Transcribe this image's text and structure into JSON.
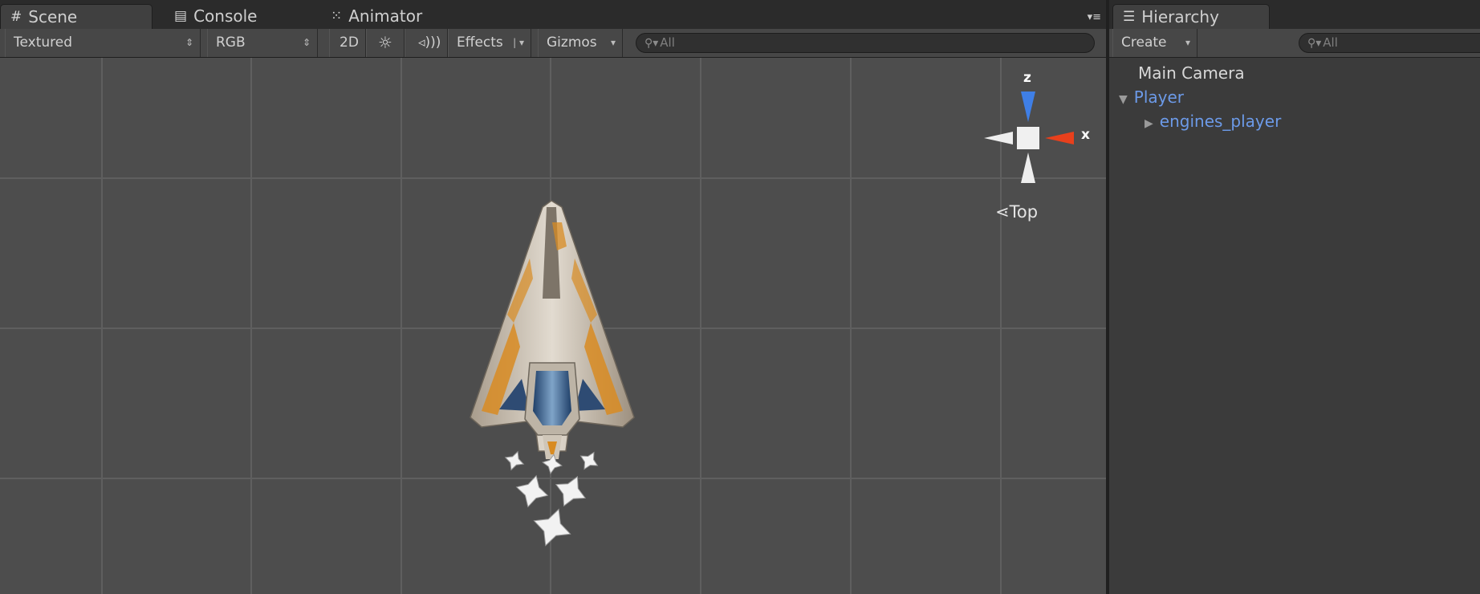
{
  "scene_tabs": {
    "scene": "Scene",
    "console": "Console",
    "animator": "Animator"
  },
  "scene_toolbar": {
    "render_mode": "Textured",
    "channel": "RGB",
    "mode_2d": "2D",
    "effects": "Effects",
    "gizmos": "Gizmos",
    "search_placeholder": "All"
  },
  "hierarchy": {
    "tab": "Hierarchy",
    "create": "Create",
    "search_placeholder": "All",
    "items": [
      {
        "label": "Main Camera",
        "depth": 0,
        "expanded": null,
        "color": "default"
      },
      {
        "label": "Player",
        "depth": 0,
        "expanded": true,
        "color": "#6c9ae8"
      },
      {
        "label": "engines_player",
        "depth": 1,
        "expanded": false,
        "color": "#6c9ae8"
      }
    ]
  },
  "gizmo": {
    "z_label": "z",
    "x_label": "x",
    "view_label": "Top"
  },
  "colors": {
    "viewport_bg": "#4d4d4d",
    "grid_line": "#5f5f5f",
    "selected_blue": "#6c9ae8",
    "axis_x": "#e8401c",
    "axis_z": "#3f7fe6"
  },
  "icons": {
    "scene_tab": "grid-icon",
    "console_tab": "console-icon",
    "animator_tab": "animator-icon",
    "hierarchy_tab": "list-icon",
    "lighting_toggle": "sun-icon",
    "audio_toggle": "speaker-icon",
    "search": "search-icon",
    "particle_gizmo": "particle-system-icon"
  }
}
